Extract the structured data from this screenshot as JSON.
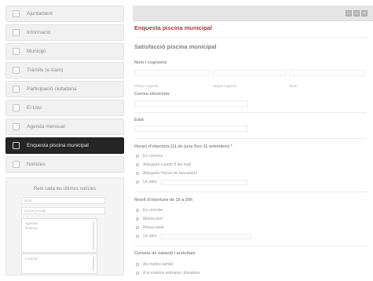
{
  "sidebar": {
    "items": [
      {
        "label": "Ajuntament",
        "icon": "building-icon"
      },
      {
        "label": "Informació",
        "icon": "info-icon"
      },
      {
        "label": "Municipi",
        "icon": "map-icon"
      },
      {
        "label": "Tràmits (e-tram)",
        "icon": "document-icon"
      },
      {
        "label": "Participació ciutadana",
        "icon": "people-icon"
      },
      {
        "label": "El Lloc",
        "icon": "pin-icon"
      },
      {
        "label": "Agenda mensual",
        "icon": "calendar-icon"
      },
      {
        "label": "Enquesta piscina municipal",
        "icon": "edit-icon",
        "active": true
      },
      {
        "label": "Notícies",
        "icon": "news-icon"
      }
    ]
  },
  "newsletter": {
    "title": "Rebi cada les últimes notícies",
    "name_placeholder": "Nom",
    "email_placeholder": "Correu e-mail",
    "list1": [
      "Agenda",
      "Notícies"
    ],
    "list2": [
      "e-tràmit"
    ]
  },
  "main": {
    "page_title": "Enquesta piscina municipal",
    "form_title": "Satisfacció piscina municipal",
    "name_label": "Nom i cognoms",
    "name_sublabels": [
      "Primer cognom",
      "Segon cognom",
      "Nom"
    ],
    "email_label": "Correu electrònic",
    "age_label": "Edat",
    "q1": {
      "label": "Horari d'obertura (11 de juny fins 11 setembre) *",
      "options": [
        "És correcte",
        "Allargaria a partir 8 del matí",
        "Allargaria l'horari de tancament",
        "Un altre"
      ]
    },
    "q2": {
      "label": "Nivell d'obertura de 10 a 20h",
      "options": [
        "És correcte",
        "Massa tard",
        "Massa aviat",
        "Un altre"
      ]
    },
    "q3": {
      "label": "Cursets de natació i activitats",
      "options": [
        "Als matins també",
        "A la mateixa setmana i dissabtes"
      ]
    }
  },
  "window_buttons": [
    "□",
    "□",
    "×"
  ]
}
